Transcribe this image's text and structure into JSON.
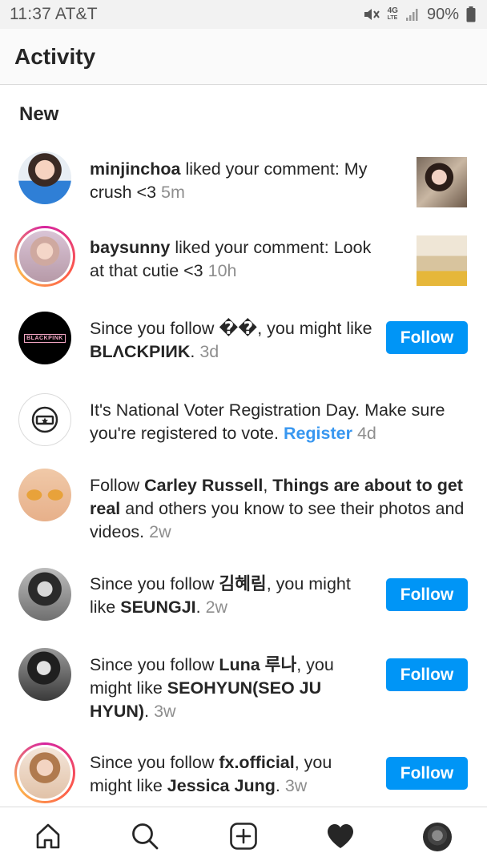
{
  "status_bar": {
    "time_carrier": "11:37 AT&T",
    "network": "4G",
    "network_sub": "LTE",
    "battery": "90%"
  },
  "header": {
    "title": "Activity"
  },
  "section": {
    "title": "New"
  },
  "notifications": [
    {
      "user": "minjinchoa",
      "text": " liked your comment: My crush <3",
      "time": "5m"
    },
    {
      "user": "baysunny",
      "text": " liked your comment: Look at that cutie <3",
      "time": "10h"
    },
    {
      "pre": "Since you follow ",
      "followed": "��",
      "mid": ", you might like ",
      "suggested": "BLΛCKPIИK",
      "post": ".",
      "time": "3d",
      "button": "Follow",
      "avatar_text": "BLACKPINK"
    },
    {
      "text": "It's National Voter Registration Day. Make sure you're registered to vote. ",
      "link": "Register",
      "time": "4d"
    },
    {
      "pre": "Follow ",
      "name1": "Carley Russell",
      "sep": ", ",
      "name2": "Things are about to get real",
      "post": " and others you know to see their photos and videos.",
      "time": "2w"
    },
    {
      "pre": "Since you follow ",
      "followed": "김혜림",
      "mid": ", you might like ",
      "suggested": "SEUNGJI",
      "post": ".",
      "time": "2w",
      "button": "Follow"
    },
    {
      "pre": "Since you follow ",
      "followed": "Luna 루나",
      "mid": ", you might like ",
      "suggested": "SEOHYUN(SEO JU HYUN)",
      "post": ".",
      "time": "3w",
      "button": "Follow"
    },
    {
      "pre": "Since you follow ",
      "followed": "fx.official",
      "mid": ", you might like ",
      "suggested": "Jessica Jung",
      "post": ".",
      "time": "3w",
      "button": "Follow"
    }
  ],
  "bottom_nav": [
    "home-icon",
    "search-icon",
    "add-post-icon",
    "heart-icon",
    "profile-avatar"
  ],
  "colors": {
    "follow_button": "#0095f6",
    "link": "#3897f0",
    "timestamp": "#8e8e8e"
  }
}
